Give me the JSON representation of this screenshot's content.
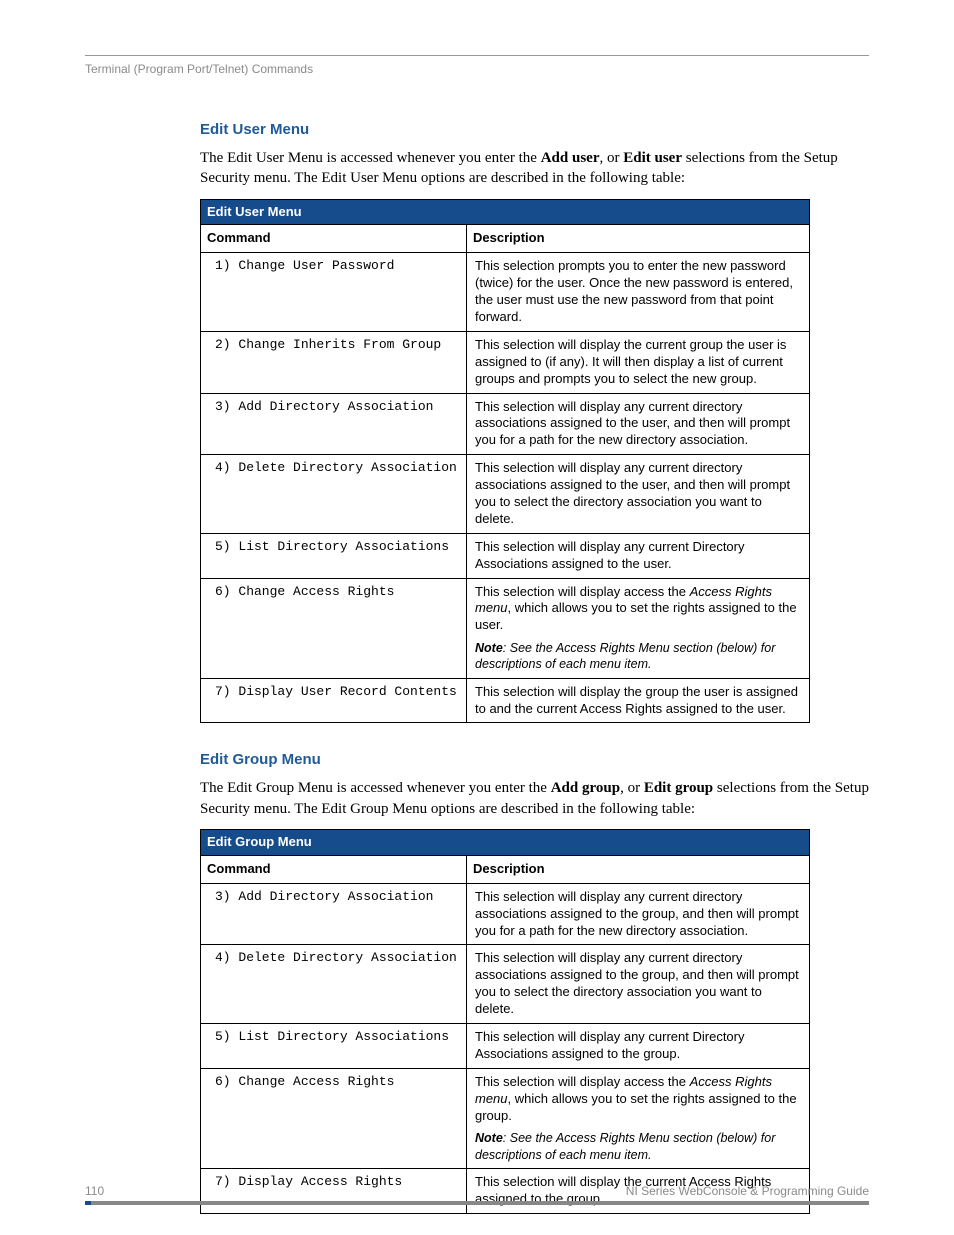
{
  "running_head": "Terminal (Program Port/Telnet) Commands",
  "section1": {
    "heading": "Edit User Menu",
    "intro_pre": "The Edit User Menu is accessed whenever you enter the ",
    "intro_b1": "Add user",
    "intro_mid": ", or ",
    "intro_b2": "Edit user",
    "intro_post": " selections from the Setup Security menu. The Edit User Menu options are described in the following table:",
    "table_title": "Edit User Menu",
    "col1": "Command",
    "col2": "Description",
    "rows": [
      {
        "cmd": "1) Change User Password",
        "desc": "This selection prompts you to enter the new password (twice) for the user. Once the new password is entered, the user must use the new password from that point forward."
      },
      {
        "cmd": "2) Change Inherits From Group",
        "desc": "This selection will display the current group the user is assigned to (if any). It will then display a list of current groups and prompts you to select the new group."
      },
      {
        "cmd": "3) Add Directory Association",
        "desc": "This selection will display any current directory associations assigned to the user, and then will prompt you for a path for the new directory association."
      },
      {
        "cmd": "4) Delete Directory Association",
        "desc": "This selection will display any current directory associations assigned to the user, and then will prompt you to select the directory association you want to delete."
      },
      {
        "cmd": "5) List Directory Associations",
        "desc": "This selection will display any current Directory Associations assigned to the user."
      },
      {
        "cmd": "6) Change Access Rights",
        "desc_pre": "This selection will display access the ",
        "desc_em": "Access Rights menu",
        "desc_post": ", which allows you to set the rights assigned to the user.",
        "note_b": "Note",
        "note_text": ": See the Access Rights Menu section (below) for descriptions of each menu item."
      },
      {
        "cmd": "7) Display User Record Contents",
        "desc": "This selection will display the group the user is assigned to and the current Access Rights assigned to the user."
      }
    ]
  },
  "section2": {
    "heading": "Edit Group Menu",
    "intro_pre": "The Edit Group Menu is accessed whenever you enter the ",
    "intro_b1": "Add group",
    "intro_mid": ", or ",
    "intro_b2": "Edit group",
    "intro_post": " selections from the Setup Security menu. The Edit Group Menu options are described in the following table:",
    "table_title": "Edit Group Menu",
    "col1": "Command",
    "col2": "Description",
    "rows": [
      {
        "cmd": "3) Add Directory Association",
        "desc": "This selection will display any current directory associations assigned to the group, and then will prompt you for a path for the new directory association."
      },
      {
        "cmd": "4) Delete Directory Association",
        "desc": "This selection will display any current directory associations assigned to the group, and then will prompt you to select the directory association you want to delete."
      },
      {
        "cmd": "5) List Directory Associations",
        "desc": "This selection will display any current Directory Associations assigned to the group."
      },
      {
        "cmd": "6) Change Access Rights",
        "desc_pre": "This selection will display access the ",
        "desc_em": "Access Rights menu",
        "desc_post": ", which allows you to set the rights assigned to the group.",
        "note_b": "Note",
        "note_text": ": See the Access Rights Menu section (below) for descriptions of each menu item."
      },
      {
        "cmd": "7) Display Access Rights",
        "desc": "This selection will display the current Access Rights assigned to the group."
      }
    ]
  },
  "footer": {
    "page": "110",
    "guide": "NI Series WebConsole & Programming Guide"
  }
}
